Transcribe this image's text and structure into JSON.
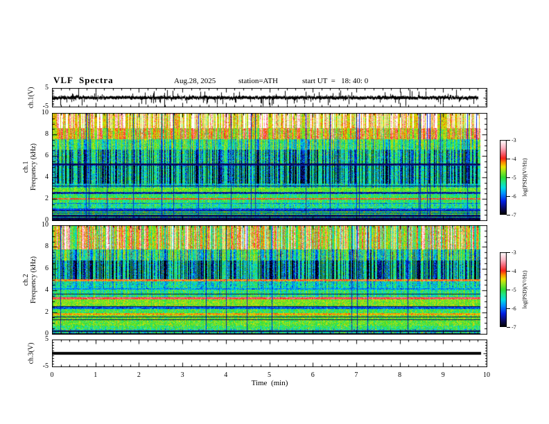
{
  "header": {
    "title": "VLF  Spectra",
    "date": "Aug.28, 2025",
    "station": "station=ATH",
    "start_ut": "start UT  =   18: 40: 0"
  },
  "axes": {
    "x_label": "Time  (min)",
    "x_ticks": [
      "0",
      "1",
      "2",
      "3",
      "4",
      "5",
      "6",
      "7",
      "8",
      "9",
      "10"
    ],
    "x_range": [
      0,
      10
    ],
    "wave_ylabel": "ch.1(V)",
    "wave_yticks": [
      "5",
      "-5"
    ],
    "wave_yrange": [
      -5,
      5
    ],
    "spec1_ylabel_l1": "ch.1",
    "spec1_ylabel_l2": "Frequency  (kHz)",
    "spec2_ylabel_l1": "ch.2",
    "spec2_ylabel_l2": "Frequency  (kHz)",
    "spec_yticks": [
      "10",
      "8",
      "6",
      "4",
      "2",
      "0"
    ],
    "spec_yrange": [
      0,
      10
    ],
    "ch3_ylabel": "ch.3(V)",
    "ch3_yticks": [
      "5",
      "-5"
    ],
    "ch3_yrange": [
      -5,
      5
    ]
  },
  "colorbar": {
    "label": "log(PSD)(V²/Hz)",
    "ticks": [
      "-3",
      "-4",
      "-5",
      "-6",
      "-7"
    ],
    "range": [
      -3,
      -7
    ]
  },
  "colors": {
    "background": "#ffffff",
    "frame": "#000000",
    "waveform": "#000000",
    "colormap": [
      [
        0.0,
        [
          0,
          0,
          0
        ]
      ],
      [
        0.08,
        [
          10,
          10,
          96
        ]
      ],
      [
        0.18,
        [
          0,
          32,
          230
        ]
      ],
      [
        0.28,
        [
          0,
          144,
          255
        ]
      ],
      [
        0.36,
        [
          0,
          221,
          229
        ]
      ],
      [
        0.44,
        [
          32,
          230,
          128
        ]
      ],
      [
        0.5,
        [
          48,
          219,
          48
        ]
      ],
      [
        0.58,
        [
          150,
          230,
          30
        ]
      ],
      [
        0.64,
        [
          236,
          226,
          0
        ]
      ],
      [
        0.7,
        [
          255,
          140,
          0
        ]
      ],
      [
        0.755,
        [
          248,
          32,
          24
        ]
      ],
      [
        0.82,
        [
          245,
          96,
          112
        ]
      ],
      [
        0.9,
        [
          250,
          182,
          196
        ]
      ],
      [
        1.0,
        [
          255,
          255,
          255
        ]
      ]
    ]
  },
  "chart_data": [
    {
      "type": "line",
      "title": "ch.1 voltage waveform",
      "xlabel": "Time (min)",
      "ylabel": "ch.1(V)",
      "xlim": [
        0,
        10
      ],
      "ylim": [
        -5,
        5
      ],
      "description": "Dense black broadband noise trace centered on 0 V, body amplitude about +/-1.5 V with frequent impulsive spikes reaching +/-5 V; data span 0 to 9.8 min",
      "render": {
        "seed": 424242,
        "body": 0.55,
        "spike_prob": 0.12,
        "spike_amp": 4.2,
        "data_frac": 0.98
      }
    },
    {
      "type": "heatmap",
      "title": "ch.1 VLF spectrogram",
      "xlabel": "Time (min)",
      "ylabel": "ch.1 Frequency (kHz)",
      "xlim": [
        0,
        10
      ],
      "ylim": [
        0,
        10
      ],
      "colorscale_label": "log(PSD)(V²/Hz)",
      "clim": [
        -7,
        -3
      ],
      "features": [
        "red/orange vertical impulsive streaks strongest 8-10 kHz on green background",
        "dense dark-blue vertical streaks 3.5-7.5 kHz",
        "dark dashed horizontal line near 5.2 kHz",
        "bright yellow/red horizontal band near 2.0 kHz",
        "grey dashed line near 2.6 kHz",
        "dense black horizontal striping below 1 kHz"
      ],
      "render": {
        "seed": 12345,
        "red_density": 0.5,
        "blue_density": 0.45,
        "dark_col_density": 0.022,
        "data_frac": 0.984,
        "bands": [
          [
            0.0,
            0.12,
            -6.9,
            0.1,
            0,
            0,
            0
          ],
          [
            0.12,
            0.55,
            -5.3,
            0.8,
            0,
            0.2,
            0.55
          ],
          [
            0.55,
            0.95,
            -5.1,
            0.7,
            0,
            0.2,
            0.3
          ],
          [
            0.95,
            1.12,
            -6.2,
            0.35,
            0,
            0,
            0
          ],
          [
            1.12,
            1.55,
            -5.15,
            0.6,
            0,
            0.25,
            0.1
          ],
          [
            1.55,
            1.66,
            -6.0,
            0.4,
            0,
            0,
            0
          ],
          [
            1.66,
            1.95,
            -5.0,
            0.5,
            0,
            0.2,
            0
          ],
          [
            1.95,
            2.12,
            -3.95,
            0.35,
            0,
            0,
            0
          ],
          [
            2.12,
            2.5,
            -5.0,
            0.5,
            0,
            0.2,
            0
          ],
          [
            2.5,
            2.68,
            -6.2,
            0.5,
            0,
            0,
            0.25
          ],
          [
            2.68,
            3.05,
            -4.8,
            0.4,
            0,
            0.1,
            0
          ],
          [
            3.05,
            3.45,
            -5.25,
            0.6,
            0,
            0.4,
            0.08
          ],
          [
            3.45,
            5.15,
            -5.35,
            0.65,
            0,
            1.0,
            0
          ],
          [
            5.15,
            5.3,
            -6.5,
            0.4,
            0,
            0,
            0.3
          ],
          [
            5.3,
            6.6,
            -5.15,
            0.6,
            0,
            0.85,
            0
          ],
          [
            6.6,
            7.6,
            -4.95,
            0.5,
            0.15,
            0.55,
            0
          ],
          [
            7.6,
            8.6,
            -4.6,
            0.45,
            0.55,
            0.2,
            0
          ],
          [
            8.6,
            10.0,
            -4.4,
            0.45,
            1.0,
            0.1,
            0
          ]
        ]
      }
    },
    {
      "type": "heatmap",
      "title": "ch.2 VLF spectrogram",
      "xlabel": "Time (min)",
      "ylabel": "ch.2 Frequency (kHz)",
      "xlim": [
        0,
        10
      ],
      "ylim": [
        0,
        10
      ],
      "colorscale_label": "log(PSD)(V²/Hz)",
      "clim": [
        -7,
        -3
      ],
      "features": [
        "red/yellow vertical streaks 8-10 kHz, blue vertical streaks 5-7.5 kHz",
        "red horizontal line near 4.9 kHz",
        "strong red horizontal line near 3.3 kHz",
        "yellow band near 1.9 kHz, grey dark band near 2.5 kHz",
        "green/yellow speckle 1-3 kHz",
        "dense black horizontal striping below 0.8 kHz"
      ],
      "render": {
        "seed": 67890,
        "red_density": 0.42,
        "blue_density": 0.5,
        "dark_col_density": 0.022,
        "data_frac": 0.984,
        "bands": [
          [
            0.0,
            0.1,
            -6.9,
            0.1,
            0,
            0,
            0
          ],
          [
            0.1,
            0.48,
            -5.2,
            0.8,
            0,
            0.2,
            0.5
          ],
          [
            0.48,
            0.82,
            -5.0,
            0.6,
            0,
            0.15,
            0.22
          ],
          [
            0.82,
            1.75,
            -4.8,
            0.5,
            0,
            0.1,
            0.05
          ],
          [
            1.75,
            1.95,
            -4.3,
            0.4,
            0,
            0,
            0
          ],
          [
            1.95,
            2.35,
            -4.95,
            0.5,
            0,
            0.15,
            0
          ],
          [
            2.35,
            2.6,
            -6.1,
            0.5,
            0,
            0,
            0.25
          ],
          [
            2.6,
            3.2,
            -4.7,
            0.45,
            0,
            0.1,
            0
          ],
          [
            3.2,
            3.38,
            -3.8,
            0.3,
            0,
            0,
            0
          ],
          [
            3.38,
            4.1,
            -5.0,
            0.55,
            0,
            0.3,
            0.05
          ],
          [
            4.1,
            4.25,
            -5.9,
            0.4,
            0,
            0,
            0
          ],
          [
            4.25,
            4.85,
            -5.2,
            0.6,
            0,
            0.35,
            0
          ],
          [
            4.85,
            5.05,
            -4.1,
            0.65,
            0,
            0,
            0
          ],
          [
            5.05,
            6.8,
            -5.3,
            0.62,
            0,
            1.0,
            0
          ],
          [
            6.8,
            7.8,
            -5.0,
            0.55,
            0.2,
            0.7,
            0
          ],
          [
            7.8,
            10.0,
            -4.55,
            0.5,
            0.8,
            0.45,
            0
          ]
        ]
      }
    },
    {
      "type": "line",
      "title": "ch.3 voltage waveform",
      "xlabel": "Time (min)",
      "ylabel": "ch.3(V)",
      "xlim": [
        0,
        10
      ],
      "ylim": [
        -5,
        5
      ],
      "description": "Flat thick black line at 0 V from 0 to 9.8 min (no signal)",
      "render": {
        "value": 0,
        "thickness": 4,
        "data_frac": 0.984
      }
    }
  ]
}
